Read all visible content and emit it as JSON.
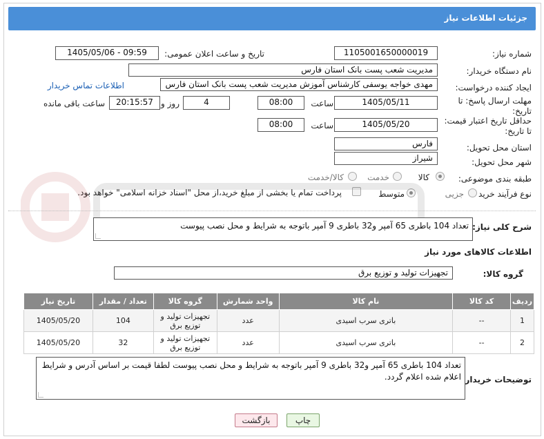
{
  "header": {
    "title": "جزئیات اطلاعات نیاز"
  },
  "form": {
    "need_number_label": "شماره نیاز:",
    "need_number": "1105001650000019",
    "announce_label": "تاریخ و ساعت اعلان عمومی:",
    "announce_value": "1405/05/06 - 09:59",
    "buyer_org_label": "نام دستگاه خریدار:",
    "buyer_org": "مدیریت شعب پست بانک استان فارس",
    "requester_label": "ایجاد کننده درخواست:",
    "requester": "مهدی خواجه یوسفی کارشناس آموزش مدیریت شعب پست بانک استان فارس",
    "contact_link": "اطلاعات تماس خریدار",
    "deadline_label_1": "مهلت ارسال پاسخ: تا",
    "deadline_label_2": "تاریخ:",
    "deadline_date": "1405/05/11",
    "time_label": "ساعت",
    "deadline_time": "08:00",
    "days_value": "4",
    "days_label": "روز و",
    "remaining_time": "20:15:57",
    "remaining_label": "ساعت باقی مانده",
    "price_valid_label_1": "حداقل تاریخ اعتبار قیمت:",
    "price_valid_label_2": "تا تاریخ:",
    "price_valid_date": "1405/05/20",
    "price_valid_time": "08:00",
    "province_label": "استان محل تحویل:",
    "province": "فارس",
    "city_label": "شهر محل تحویل:",
    "city": "شیراز",
    "category_label": "طبقه بندی موضوعی:",
    "category_options": [
      "کالا",
      "خدمت",
      "کالا/خدمت"
    ],
    "process_label": "نوع فرآیند خرید :",
    "process_options": [
      "جزیی",
      "متوسط"
    ],
    "payment_note": "پرداخت تمام یا بخشی از مبلغ خرید،از محل \"اسناد خزانه اسلامی\" خواهد بود."
  },
  "description": {
    "label": "شرح کلی نیاز:",
    "text": "تعداد 104 باطری 65 آمپر و32 باطری 9 آمپر باتوجه به شرایط و محل نصب پیوست"
  },
  "goods": {
    "section_title": "اطلاعات کالاهای مورد نیاز",
    "group_label": "گروه کالا:",
    "group_value": "تجهیزات تولید و توزیع برق",
    "columns": [
      "ردیف",
      "کد کالا",
      "نام کالا",
      "واحد شمارش",
      "گروه کالا",
      "تعداد / مقدار",
      "تاریخ نیاز"
    ],
    "rows": [
      [
        "1",
        "--",
        "باتری سرب اسیدی",
        "عدد",
        "تجهیزات تولید و توزیع برق",
        "104",
        "1405/05/20"
      ],
      [
        "2",
        "--",
        "باتری سرب اسیدی",
        "عدد",
        "تجهیزات تولید و توزیع برق",
        "32",
        "1405/05/20"
      ]
    ]
  },
  "buyer_notes": {
    "label": "توضیحات خریدار:",
    "text": "تعداد 104 باطری 65 آمپر و32 باطری 9 آمپر باتوجه به شرایط و محل نصب پیوست لطفا قیمت بر اساس آدرس و شرایط اعلام شده اعلام گردد."
  },
  "buttons": {
    "print": "چاپ",
    "back": "بازگشت"
  },
  "colors": {
    "title_bar": "#4a8fd8",
    "table_header": "#8a8a8a"
  }
}
